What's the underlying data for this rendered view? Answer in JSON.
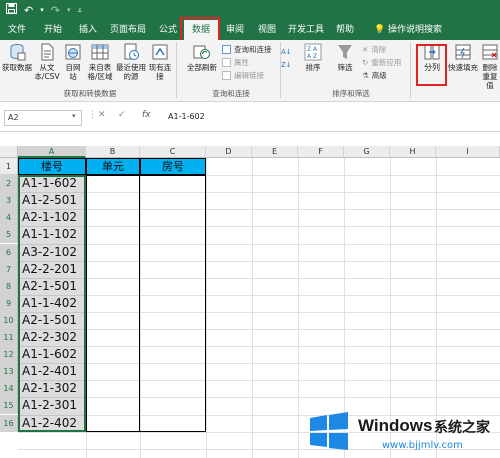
{
  "qat": {
    "undo": "↶",
    "redo": "↷"
  },
  "tabs": [
    "文件",
    "开始",
    "插入",
    "页面布局",
    "公式",
    "数据",
    "审阅",
    "视图",
    "开发工具",
    "帮助"
  ],
  "tell_me": "操作说明搜索",
  "ribbon": {
    "get_data": "获取数据",
    "from_csv": "从文本/CSV",
    "from_web": "自网站",
    "from_table": "来自表格/区域",
    "recent_sources": "最近使用的源",
    "existing_conn": "现有连接",
    "group_get": "获取和转换数据",
    "refresh_all": "全部刷新",
    "queries_conn": "查询和连接",
    "properties": "属性",
    "edit_links": "编辑链接",
    "group_queries": "查询和连接",
    "sort": "排序",
    "filter": "筛选",
    "clear": "清除",
    "reapply": "重新应用",
    "advanced": "高级",
    "group_sort": "排序和筛选",
    "text_to_columns": "分列",
    "flash_fill": "快速填充",
    "remove_dup": "删除重复值"
  },
  "formula": {
    "namebox": "A2",
    "content": "A1-1-602",
    "fx": "fx"
  },
  "columns": [
    "A",
    "B",
    "C",
    "D",
    "E",
    "F",
    "G",
    "H",
    "I"
  ],
  "rows": [
    "1",
    "2",
    "3",
    "4",
    "5",
    "6",
    "7",
    "8",
    "9",
    "10",
    "11",
    "12",
    "13",
    "14",
    "15",
    "16"
  ],
  "header": {
    "a": "楼号",
    "b": "单元",
    "c": "房号"
  },
  "values": [
    "A1-1-602",
    "A1-2-501",
    "A2-1-102",
    "A1-1-102",
    "A3-2-102",
    "A2-2-201",
    "A2-1-501",
    "A1-1-402",
    "A2-1-501",
    "A2-2-302",
    "A1-1-602",
    "A1-2-401",
    "A2-1-302",
    "A1-2-301",
    "A1-2-402"
  ],
  "watermark": {
    "title": "Windows",
    "brand": "系统之家",
    "url": "www.bjjmlv.com"
  },
  "colors": {
    "accent": "#217346",
    "header_fill": "#00b0f0",
    "highlight": "#e02424"
  }
}
